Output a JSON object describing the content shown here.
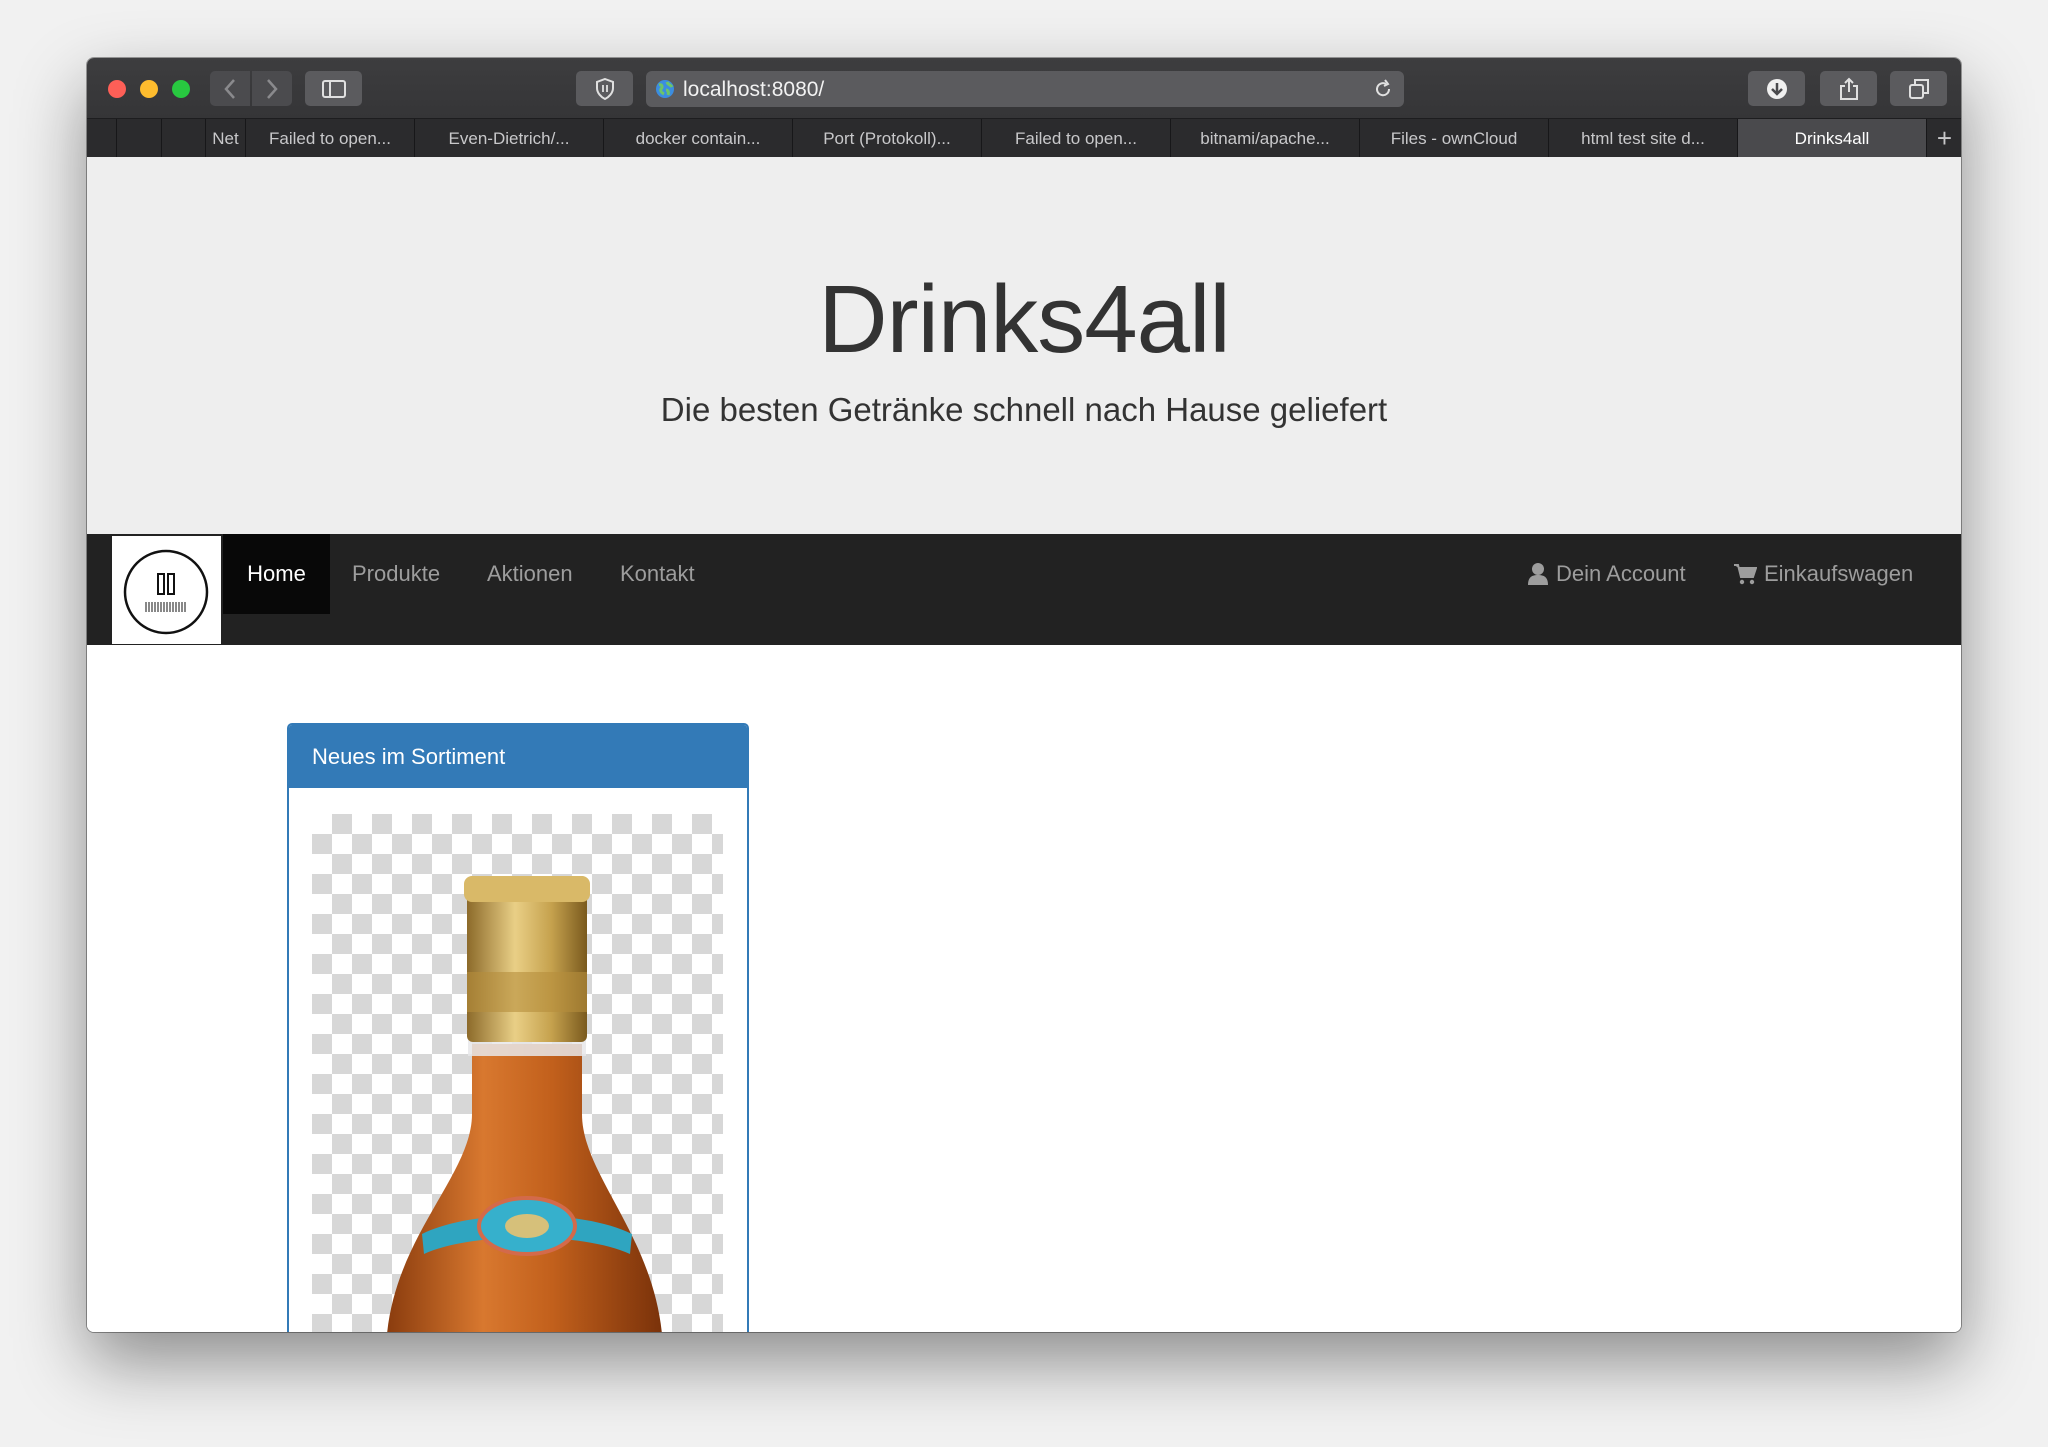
{
  "browser": {
    "url": "localhost:8080/",
    "tabs": [
      {
        "label": "Net"
      },
      {
        "label": "Failed to open..."
      },
      {
        "label": "Even-Dietrich/..."
      },
      {
        "label": "docker contain..."
      },
      {
        "label": "Port (Protokoll)..."
      },
      {
        "label": "Failed to open..."
      },
      {
        "label": "bitnami/apache..."
      },
      {
        "label": "Files - ownCloud"
      },
      {
        "label": "html test site d..."
      },
      {
        "label": "Drinks4all"
      }
    ],
    "new_tab_symbol": "+"
  },
  "site": {
    "title": "Drinks4all",
    "subtitle": "Die besten Getränke schnell nach Hause geliefert"
  },
  "nav": {
    "items": [
      {
        "label": "Home"
      },
      {
        "label": "Produkte"
      },
      {
        "label": "Aktionen"
      },
      {
        "label": "Kontakt"
      }
    ],
    "account_label": "Dein Account",
    "cart_label": "Einkaufswagen"
  },
  "panel": {
    "heading": "Neues im Sortiment"
  },
  "colors": {
    "primary": "#337ab7",
    "navbar": "#222222",
    "jumbotron": "#eeeeee"
  },
  "icons": [
    "back-icon",
    "forward-icon",
    "sidebar-icon",
    "shield-icon",
    "globe-icon",
    "reload-icon",
    "download-icon",
    "share-icon",
    "tabs-overview-icon",
    "user-icon",
    "cart-icon"
  ]
}
